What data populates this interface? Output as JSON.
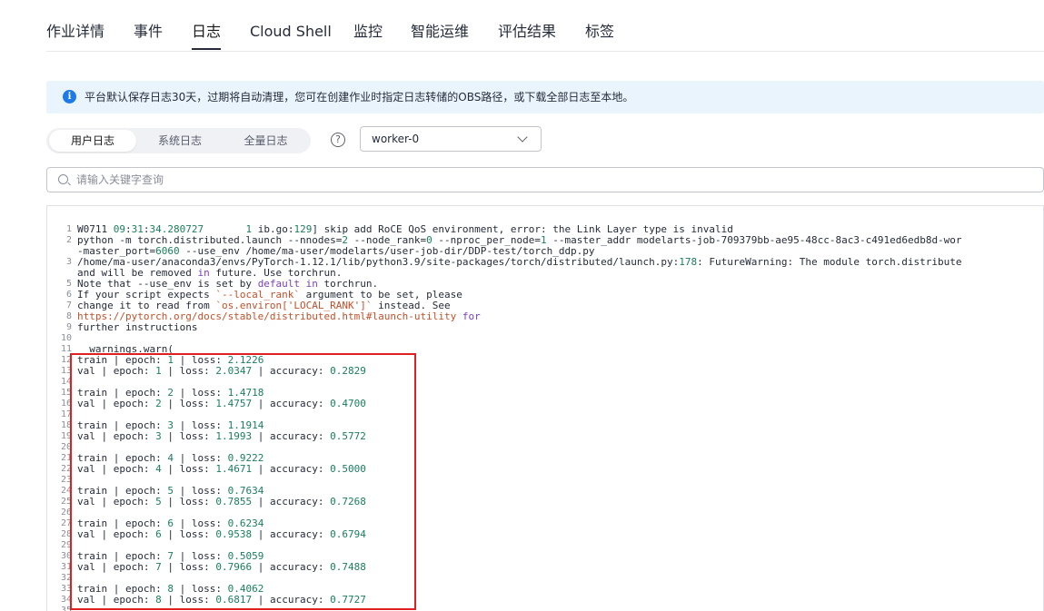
{
  "tabs": [
    {
      "label": "作业详情"
    },
    {
      "label": "事件"
    },
    {
      "label": "日志"
    },
    {
      "label": "Cloud Shell"
    },
    {
      "label": "监控"
    },
    {
      "label": "智能运维"
    },
    {
      "label": "评估结果"
    },
    {
      "label": "标签"
    }
  ],
  "active_tab": "日志",
  "banner": {
    "text": "平台默认保存日志30天，过期将自动清理，您可在创建作业时指定日志转储的OBS路径，或下载全部日志至本地。",
    "icon": "info-icon"
  },
  "log_types": [
    {
      "label": "用户日志"
    },
    {
      "label": "系统日志"
    },
    {
      "label": "全量日志"
    }
  ],
  "active_log_type": "用户日志",
  "node_select": {
    "value": "worker-0"
  },
  "search": {
    "placeholder": "请输入关键字查询"
  },
  "log_lines": [
    {
      "num": "1",
      "text": "W0711 09:31:34.280727       1 ib.go:129] skip add RoCE QoS environment, error: the Link Layer type is invalid"
    },
    {
      "num": "2",
      "text": "python -m torch.distributed.launch --nnodes=2 --node_rank=0 --nproc_per_node=1 --master_addr modelarts-job-709379bb-ae95-48cc-8ac3-c491ed6edb8d-wor"
    },
    {
      "num": "",
      "text": "-master_port=6060 --use_env /home/ma-user/modelarts/user-job-dir/DDP-test/torch_ddp.py"
    },
    {
      "num": "3",
      "text": "/home/ma-user/anaconda3/envs/PyTorch-1.12.1/lib/python3.9/site-packages/torch/distributed/launch.py:178: FutureWarning: The module torch.distribute"
    },
    {
      "num": "",
      "text": "and will be removed in future. Use torchrun."
    },
    {
      "num": "5",
      "text": "Note that --use_env is set by default in torchrun."
    },
    {
      "num": "6",
      "text": "If your script expects `--local_rank` argument to be set, please"
    },
    {
      "num": "7",
      "text": "change it to read from `os.environ['LOCAL_RANK']` instead. See"
    },
    {
      "num": "8",
      "text": "https://pytorch.org/docs/stable/distributed.html#launch-utility for"
    },
    {
      "num": "9",
      "text": "further instructions"
    },
    {
      "num": "10",
      "text": ""
    },
    {
      "num": "11",
      "text": "  warnings.warn("
    },
    {
      "num": "12",
      "text": "train | epoch: 1 | loss: 2.1226"
    },
    {
      "num": "13",
      "text": "val | epoch: 1 | loss: 2.0347 | accuracy: 0.2829"
    },
    {
      "num": "14",
      "text": ""
    },
    {
      "num": "15",
      "text": "train | epoch: 2 | loss: 1.4718"
    },
    {
      "num": "16",
      "text": "val | epoch: 2 | loss: 1.4757 | accuracy: 0.4700"
    },
    {
      "num": "17",
      "text": ""
    },
    {
      "num": "18",
      "text": "train | epoch: 3 | loss: 1.1914"
    },
    {
      "num": "19",
      "text": "val | epoch: 3 | loss: 1.1993 | accuracy: 0.5772"
    },
    {
      "num": "20",
      "text": ""
    },
    {
      "num": "21",
      "text": "train | epoch: 4 | loss: 0.9222"
    },
    {
      "num": "22",
      "text": "val | epoch: 4 | loss: 1.4671 | accuracy: 0.5000"
    },
    {
      "num": "23",
      "text": ""
    },
    {
      "num": "24",
      "text": "train | epoch: 5 | loss: 0.7634"
    },
    {
      "num": "25",
      "text": "val | epoch: 5 | loss: 0.7855 | accuracy: 0.7268"
    },
    {
      "num": "26",
      "text": ""
    },
    {
      "num": "27",
      "text": "train | epoch: 6 | loss: 0.6234"
    },
    {
      "num": "28",
      "text": "val | epoch: 6 | loss: 0.9538 | accuracy: 0.6794"
    },
    {
      "num": "29",
      "text": ""
    },
    {
      "num": "30",
      "text": "train | epoch: 7 | loss: 0.5059"
    },
    {
      "num": "31",
      "text": "val | epoch: 7 | loss: 0.7966 | accuracy: 0.7488"
    },
    {
      "num": "32",
      "text": ""
    },
    {
      "num": "33",
      "text": "train | epoch: 8 | loss: 0.4062"
    },
    {
      "num": "34",
      "text": "val | epoch: 8 | loss: 0.6817 | accuracy: 0.7727"
    },
    {
      "num": "35",
      "text": ""
    }
  ],
  "colors": {
    "number": "#1a7f5a",
    "keyword": "#7a3ebf",
    "string": "#c2502a",
    "highlight_box": "#e02020",
    "banner_bg": "#eaf4fd",
    "info_icon": "#1d7ae8"
  }
}
